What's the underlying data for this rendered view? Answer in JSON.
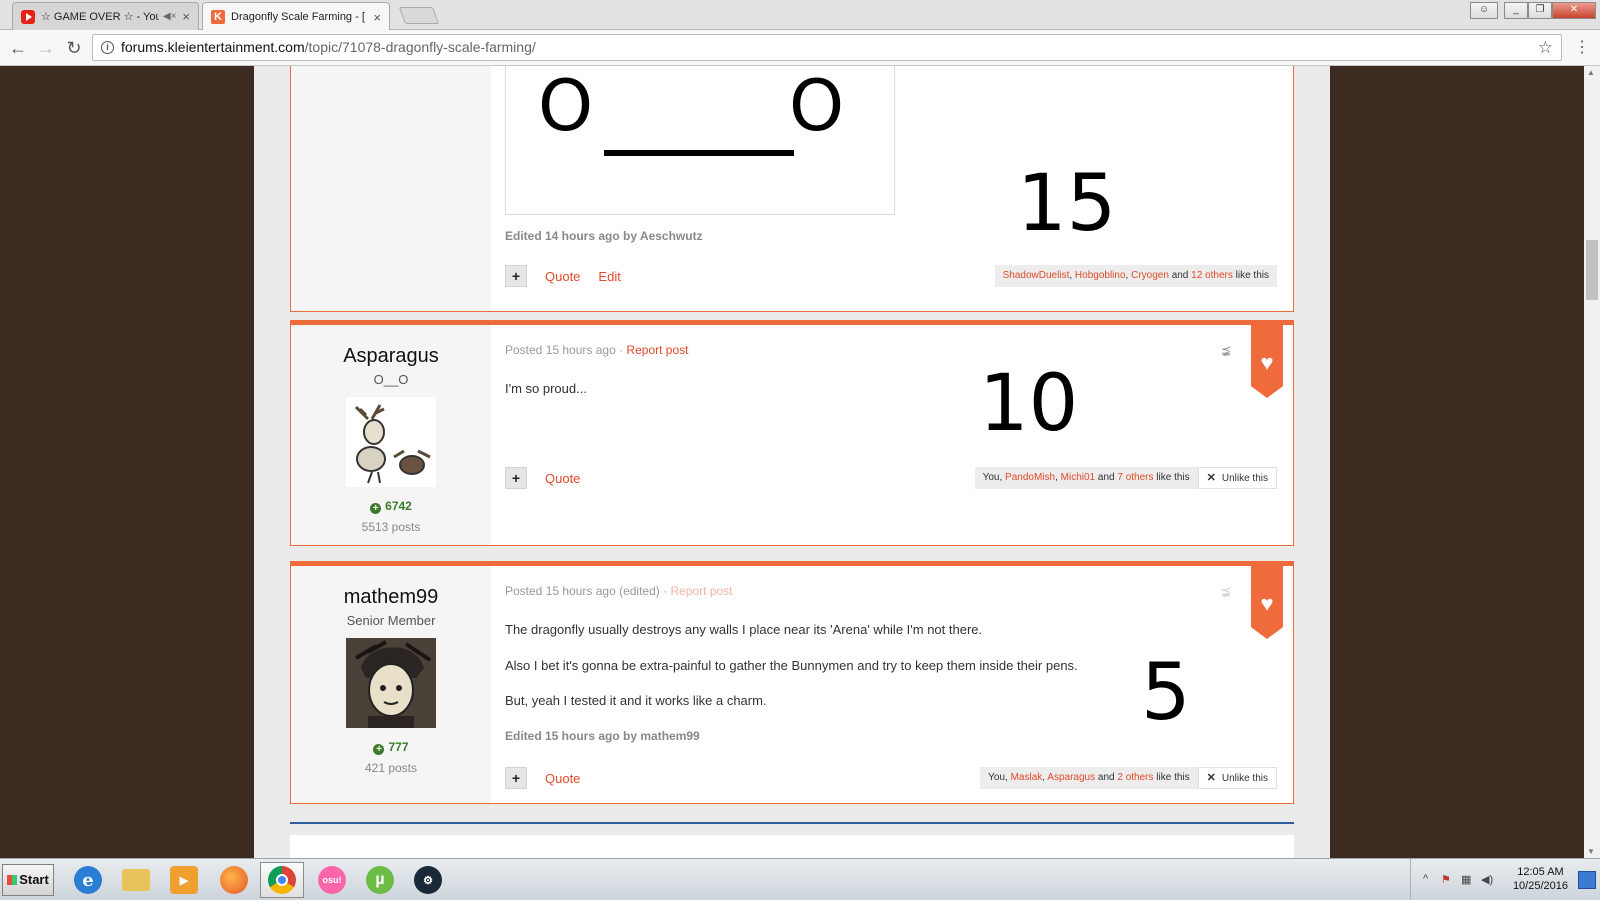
{
  "browser": {
    "tabs": [
      {
        "title": "☆ GAME OVER ☆ - You",
        "icon": "youtube-icon",
        "muted": true
      },
      {
        "title": "Dragonfly Scale Farming - [",
        "icon": "klei-icon",
        "active": true
      }
    ],
    "url_host": "forums.kleientertainment.com",
    "url_path": "/topic/71078-dragonfly-scale-farming/",
    "window_buttons": [
      "user",
      "minimize",
      "restore",
      "close"
    ]
  },
  "posts": [
    {
      "edited": "Edited 14 hours ago by Aeschwutz",
      "actions": [
        "Quote",
        "Edit"
      ],
      "likes": {
        "users": [
          "ShadowDuelist",
          "Hobgoblino",
          "Cryogen"
        ],
        "others": "12 others",
        "suffix": "like this",
        "and": "and"
      },
      "overlay_number": "15",
      "quote_image": {
        "left": "O",
        "right": "O"
      }
    },
    {
      "author": "Asparagus",
      "author_title": "O__O",
      "reputation": "6742",
      "post_count": "5513 posts",
      "posted": "Posted 15 hours ago",
      "report": "Report post",
      "body": [
        "I'm so proud..."
      ],
      "actions": [
        "Quote"
      ],
      "likes": {
        "prefix": "You,",
        "users": [
          "PandoMish",
          "Michi01"
        ],
        "others": "7 others",
        "suffix": "like this",
        "and": "and"
      },
      "unlike": "Unlike this",
      "overlay_number": "10"
    },
    {
      "author": "mathem99",
      "author_title": "Senior Member",
      "reputation": "777",
      "post_count": "421 posts",
      "posted": "Posted 15 hours ago (edited)",
      "report": "Report post",
      "body": [
        "The dragonfly usually destroys any walls I place near its 'Arena' while I'm not there.",
        "Also I bet it's gonna be extra-painful to gather the Bunnymen and try to keep them inside their pens.",
        "But, yeah I tested it and it works like a charm."
      ],
      "edited": "Edited 15 hours ago by mathem99",
      "actions": [
        "Quote"
      ],
      "likes": {
        "prefix": "You,",
        "users": [
          "Maslak",
          "Asparagus"
        ],
        "others": "2 others",
        "suffix": "like this",
        "and": "and"
      },
      "unlike": "Unlike this",
      "overlay_number": "5"
    }
  ],
  "taskbar": {
    "start": "Start",
    "apps": [
      "internet-explorer",
      "file-explorer",
      "media-player",
      "firefox",
      "chrome",
      "osu",
      "utorrent",
      "steam"
    ],
    "osu_label": "osu!",
    "time": "12:05 AM",
    "date": "10/25/2016"
  },
  "colors": {
    "accent": "#ef6b3c",
    "link": "#e04a2a",
    "background": "#3d2b22"
  }
}
